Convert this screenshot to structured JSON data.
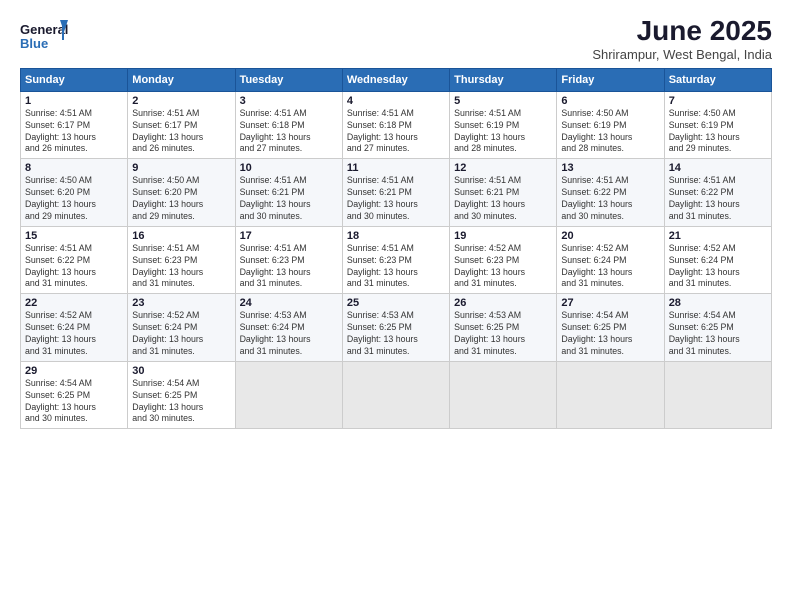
{
  "header": {
    "logo_general": "General",
    "logo_blue": "Blue",
    "title": "June 2025",
    "subtitle": "Shrirampur, West Bengal, India"
  },
  "days_of_week": [
    "Sunday",
    "Monday",
    "Tuesday",
    "Wednesday",
    "Thursday",
    "Friday",
    "Saturday"
  ],
  "weeks": [
    [
      {
        "num": "1",
        "sunrise": "4:51 AM",
        "sunset": "6:17 PM",
        "daylight": "13 hours and 26 minutes."
      },
      {
        "num": "2",
        "sunrise": "4:51 AM",
        "sunset": "6:17 PM",
        "daylight": "13 hours and 26 minutes."
      },
      {
        "num": "3",
        "sunrise": "4:51 AM",
        "sunset": "6:18 PM",
        "daylight": "13 hours and 27 minutes."
      },
      {
        "num": "4",
        "sunrise": "4:51 AM",
        "sunset": "6:18 PM",
        "daylight": "13 hours and 27 minutes."
      },
      {
        "num": "5",
        "sunrise": "4:51 AM",
        "sunset": "6:19 PM",
        "daylight": "13 hours and 28 minutes."
      },
      {
        "num": "6",
        "sunrise": "4:50 AM",
        "sunset": "6:19 PM",
        "daylight": "13 hours and 28 minutes."
      },
      {
        "num": "7",
        "sunrise": "4:50 AM",
        "sunset": "6:19 PM",
        "daylight": "13 hours and 29 minutes."
      }
    ],
    [
      {
        "num": "8",
        "sunrise": "4:50 AM",
        "sunset": "6:20 PM",
        "daylight": "13 hours and 29 minutes."
      },
      {
        "num": "9",
        "sunrise": "4:50 AM",
        "sunset": "6:20 PM",
        "daylight": "13 hours and 29 minutes."
      },
      {
        "num": "10",
        "sunrise": "4:51 AM",
        "sunset": "6:21 PM",
        "daylight": "13 hours and 30 minutes."
      },
      {
        "num": "11",
        "sunrise": "4:51 AM",
        "sunset": "6:21 PM",
        "daylight": "13 hours and 30 minutes."
      },
      {
        "num": "12",
        "sunrise": "4:51 AM",
        "sunset": "6:21 PM",
        "daylight": "13 hours and 30 minutes."
      },
      {
        "num": "13",
        "sunrise": "4:51 AM",
        "sunset": "6:22 PM",
        "daylight": "13 hours and 30 minutes."
      },
      {
        "num": "14",
        "sunrise": "4:51 AM",
        "sunset": "6:22 PM",
        "daylight": "13 hours and 31 minutes."
      }
    ],
    [
      {
        "num": "15",
        "sunrise": "4:51 AM",
        "sunset": "6:22 PM",
        "daylight": "13 hours and 31 minutes."
      },
      {
        "num": "16",
        "sunrise": "4:51 AM",
        "sunset": "6:23 PM",
        "daylight": "13 hours and 31 minutes."
      },
      {
        "num": "17",
        "sunrise": "4:51 AM",
        "sunset": "6:23 PM",
        "daylight": "13 hours and 31 minutes."
      },
      {
        "num": "18",
        "sunrise": "4:51 AM",
        "sunset": "6:23 PM",
        "daylight": "13 hours and 31 minutes."
      },
      {
        "num": "19",
        "sunrise": "4:52 AM",
        "sunset": "6:23 PM",
        "daylight": "13 hours and 31 minutes."
      },
      {
        "num": "20",
        "sunrise": "4:52 AM",
        "sunset": "6:24 PM",
        "daylight": "13 hours and 31 minutes."
      },
      {
        "num": "21",
        "sunrise": "4:52 AM",
        "sunset": "6:24 PM",
        "daylight": "13 hours and 31 minutes."
      }
    ],
    [
      {
        "num": "22",
        "sunrise": "4:52 AM",
        "sunset": "6:24 PM",
        "daylight": "13 hours and 31 minutes."
      },
      {
        "num": "23",
        "sunrise": "4:52 AM",
        "sunset": "6:24 PM",
        "daylight": "13 hours and 31 minutes."
      },
      {
        "num": "24",
        "sunrise": "4:53 AM",
        "sunset": "6:24 PM",
        "daylight": "13 hours and 31 minutes."
      },
      {
        "num": "25",
        "sunrise": "4:53 AM",
        "sunset": "6:25 PM",
        "daylight": "13 hours and 31 minutes."
      },
      {
        "num": "26",
        "sunrise": "4:53 AM",
        "sunset": "6:25 PM",
        "daylight": "13 hours and 31 minutes."
      },
      {
        "num": "27",
        "sunrise": "4:54 AM",
        "sunset": "6:25 PM",
        "daylight": "13 hours and 31 minutes."
      },
      {
        "num": "28",
        "sunrise": "4:54 AM",
        "sunset": "6:25 PM",
        "daylight": "13 hours and 31 minutes."
      }
    ],
    [
      {
        "num": "29",
        "sunrise": "4:54 AM",
        "sunset": "6:25 PM",
        "daylight": "13 hours and 30 minutes."
      },
      {
        "num": "30",
        "sunrise": "4:54 AM",
        "sunset": "6:25 PM",
        "daylight": "13 hours and 30 minutes."
      },
      null,
      null,
      null,
      null,
      null
    ]
  ],
  "labels": {
    "sunrise": "Sunrise:",
    "sunset": "Sunset:",
    "daylight": "Daylight:"
  }
}
